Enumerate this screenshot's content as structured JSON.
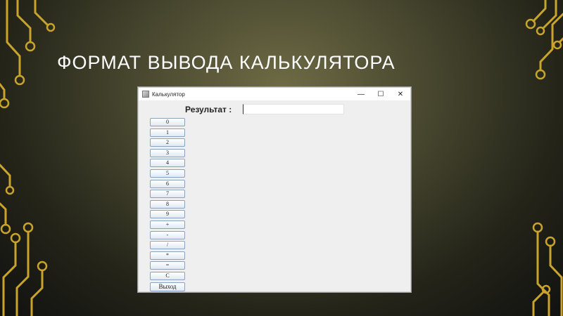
{
  "slide": {
    "title": "ФОРМАТ ВЫВОДА КАЛЬКУЛЯТОРА"
  },
  "window": {
    "title": "Калькулятор",
    "controls": {
      "minimize": "—",
      "maximize": "☐",
      "close": "✕"
    },
    "result_label": "Результат :",
    "result_value": "",
    "buttons": [
      "0",
      "1",
      "2",
      "3",
      "4",
      "5",
      "6",
      "7",
      "8",
      "9",
      "+",
      "-",
      "/",
      "*",
      "=",
      "C",
      "Выход"
    ]
  },
  "colors": {
    "accent_gold": "#c9a42c",
    "button_border": "#8aa2bd",
    "title_text": "#ffffff"
  }
}
